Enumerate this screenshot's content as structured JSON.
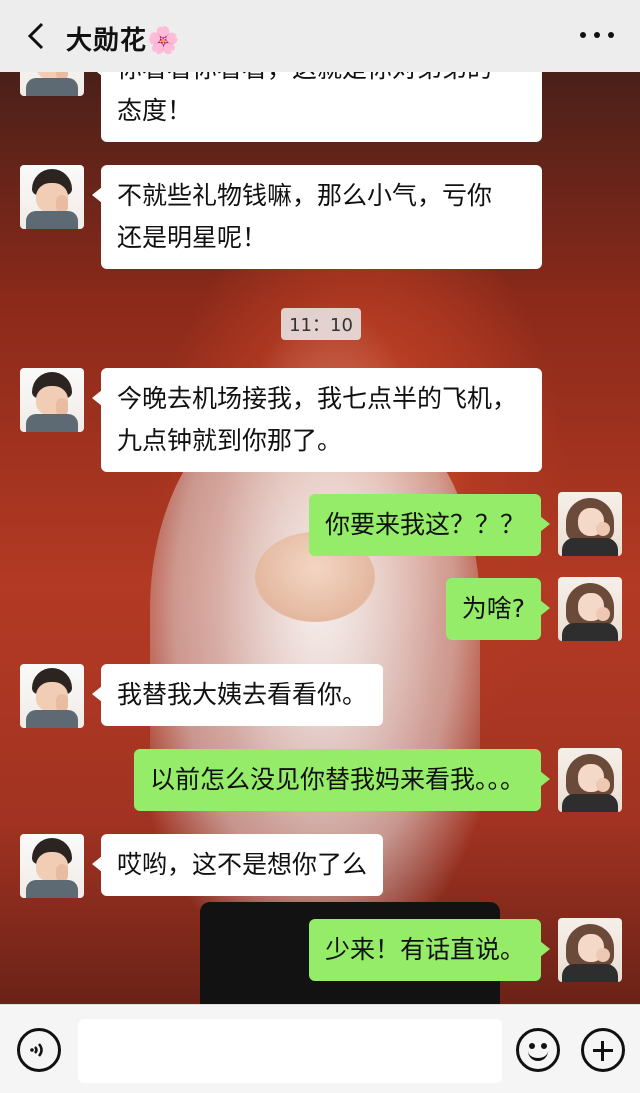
{
  "header": {
    "title": "大勋花🌸",
    "back_icon": "chevron-left-icon",
    "more_icon": "more-dots-icon"
  },
  "colors": {
    "header_bg": "#ededed",
    "bubble_self": "#95ec69",
    "bubble_other": "#ffffff",
    "input_bar_bg": "#f5f5f5"
  },
  "messages": [
    {
      "sender": "other",
      "text_line1": "你看看你看看，这就是你对弟弟的",
      "text_line2": "态度！"
    },
    {
      "sender": "other",
      "text_line1": "不就些礼物钱嘛，那么小气，亏你",
      "text_line2": "还是明星呢！"
    },
    {
      "type": "timestamp",
      "text": "11：10"
    },
    {
      "sender": "other",
      "text_line1": "今晚去机场接我，我七点半的飞机，",
      "text_line2": "九点钟就到你那了。"
    },
    {
      "sender": "self",
      "text": "你要来我这？？？"
    },
    {
      "sender": "self",
      "text": "为啥?"
    },
    {
      "sender": "other",
      "text": "我替我大姨去看看你。"
    },
    {
      "sender": "self",
      "text": "以前怎么没见你替我妈来看我。。。"
    },
    {
      "sender": "other",
      "text": "哎哟，这不是想你了么"
    },
    {
      "sender": "self",
      "text": "少来！有话直说。"
    }
  ],
  "input_bar": {
    "voice_icon": "voice-icon",
    "input_value": "",
    "emoji_icon": "emoji-icon",
    "plus_icon": "plus-icon"
  }
}
